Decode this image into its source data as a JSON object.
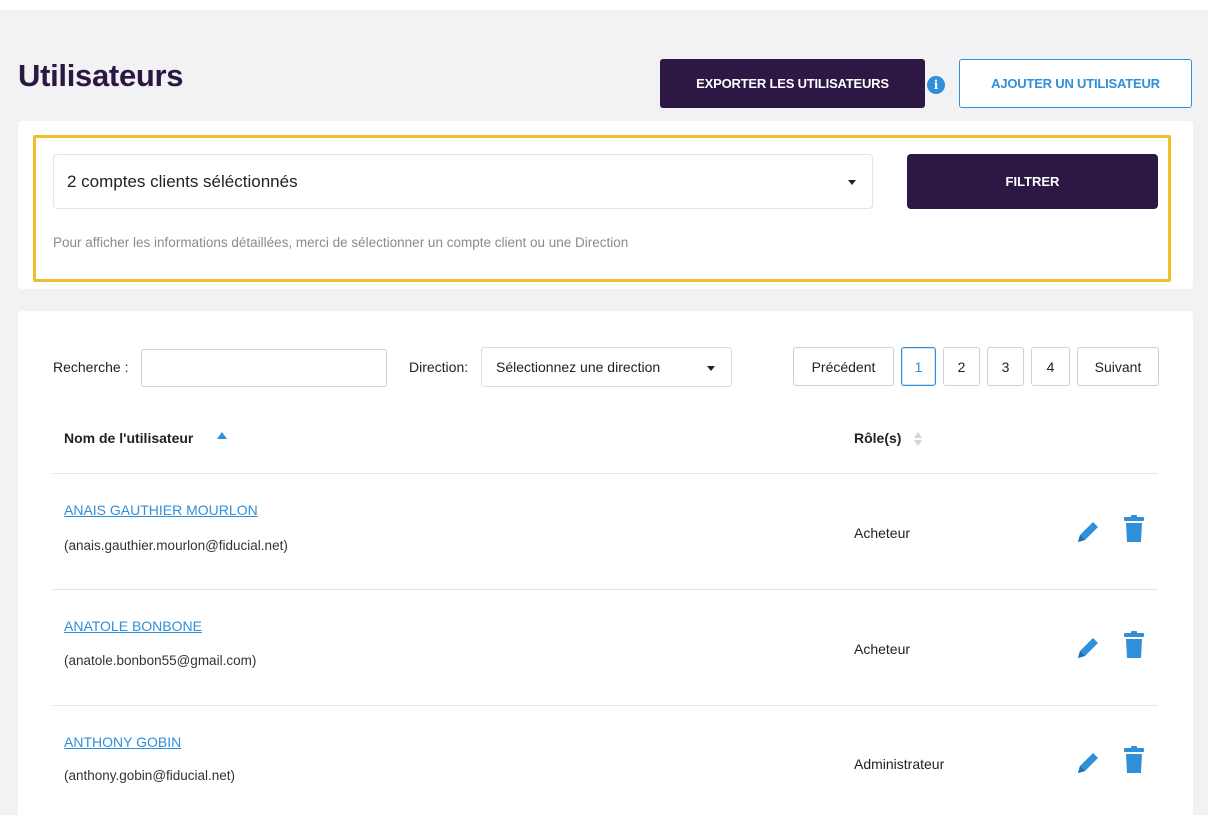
{
  "header": {
    "title": "Utilisateurs",
    "export_label": "EXPORTER LES UTILISATEURS",
    "info_glyph": "i",
    "add_label": "AJOUTER UN UTILISATEUR"
  },
  "filter": {
    "selected_accounts": "2 comptes clients séléctionnés",
    "filter_label": "FILTRER",
    "hint": "Pour afficher les informations détaillées, merci de sélectionner un compte client ou une Direction"
  },
  "toolbar": {
    "search_label": "Recherche :",
    "search_value": "",
    "direction_label": "Direction:",
    "direction_placeholder": "Sélectionnez une direction"
  },
  "pagination": {
    "previous": "Précédent",
    "pages": [
      "1",
      "2",
      "3",
      "4"
    ],
    "current": "1",
    "next": "Suivant"
  },
  "table": {
    "columns": {
      "name": "Nom de l'utilisateur",
      "roles": "Rôle(s)"
    },
    "rows": [
      {
        "name": "ANAIS GAUTHIER MOURLON",
        "email": "(anais.gauthier.mourlon@fiducial.net)",
        "role": "Acheteur"
      },
      {
        "name": "ANATOLE BONBONE",
        "email": "(anatole.bonbon55@gmail.com)",
        "role": "Acheteur"
      },
      {
        "name": "ANTHONY GOBIN",
        "email": "(anthony.gobin@fiducial.net)",
        "role": "Administrateur"
      }
    ]
  },
  "icons": {
    "info": "info-icon",
    "dropdown": "chevron-down-icon",
    "sort_ascending": "sort-ascending-icon",
    "sortable": "sort-icon",
    "edit": "pencil-icon",
    "delete": "trash-icon"
  },
  "colors": {
    "brand_dark": "#2d1745",
    "accent_blue": "#2f8fd8",
    "highlight": "#f2bf2a"
  }
}
